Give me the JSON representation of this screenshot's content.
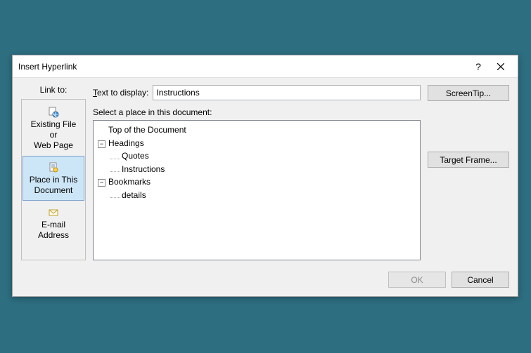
{
  "dialog": {
    "title": "Insert Hyperlink",
    "help_tooltip": "?",
    "linkto_label": "Link to:",
    "text_to_display_label": "Text to display:",
    "text_to_display_value": "Instructions",
    "select_place_label": "Select a place in this document:",
    "linkto_items": [
      {
        "icon": "globe-file-icon",
        "line1": "Existing File or",
        "line2": "Web Page",
        "selected": false
      },
      {
        "icon": "doc-anchor-icon",
        "line1": "Place in This",
        "line2": "Document",
        "selected": true
      },
      {
        "icon": "mail-icon",
        "line1": "E-mail Address",
        "line2": "",
        "selected": false
      }
    ],
    "tree": {
      "top": "Top of the Document",
      "headings": {
        "label": "Headings",
        "children": [
          "Quotes",
          "Instructions"
        ]
      },
      "bookmarks": {
        "label": "Bookmarks",
        "children": [
          "details"
        ]
      }
    },
    "buttons": {
      "screentip": "ScreenTip...",
      "target_frame": "Target Frame...",
      "ok": "OK",
      "cancel": "Cancel"
    }
  }
}
